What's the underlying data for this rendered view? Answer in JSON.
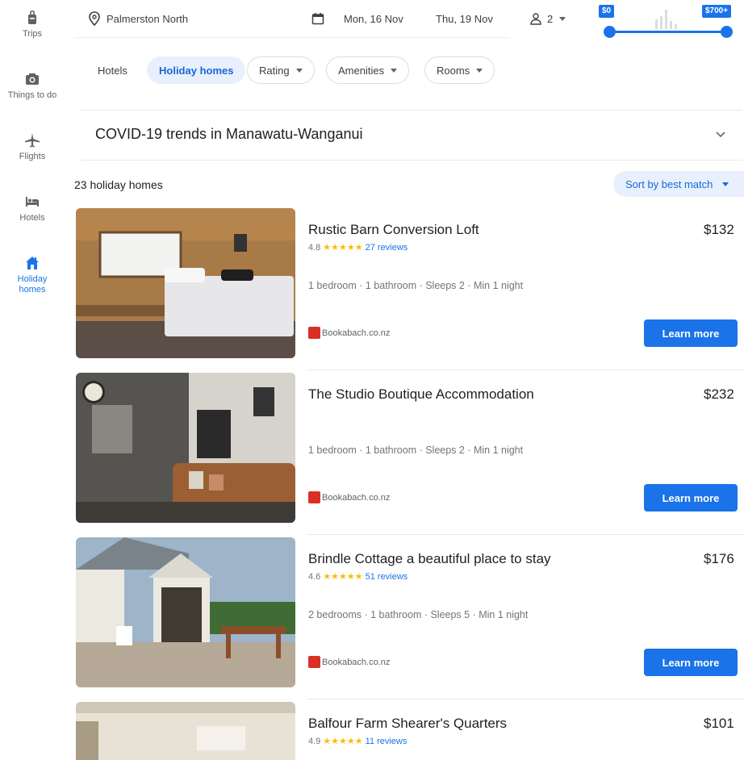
{
  "sidebar": {
    "items": [
      {
        "label": "Trips",
        "icon": "luggage-icon"
      },
      {
        "label": "Things to do",
        "icon": "camera-icon"
      },
      {
        "label": "Flights",
        "icon": "airplane-icon"
      },
      {
        "label": "Hotels",
        "icon": "bed-icon"
      },
      {
        "label": "Holiday homes",
        "icon": "house-icon",
        "active": true
      }
    ]
  },
  "search": {
    "location": "Palmerston North",
    "check_in": "Mon, 16 Nov",
    "check_out": "Thu, 19 Nov",
    "guests": "2"
  },
  "price_filter": {
    "min_label": "$0",
    "max_label": "$700+"
  },
  "filters": {
    "hotels": "Hotels",
    "holiday_homes": "Holiday homes",
    "rating": "Rating",
    "amenities": "Amenities",
    "rooms": "Rooms"
  },
  "covid": {
    "title": "COVID-19 trends in Manawatu-Wanganui"
  },
  "results": {
    "count_label": "23 holiday homes",
    "sort_label": "Sort by best match"
  },
  "listings": [
    {
      "title": "Rustic Barn Conversion Loft",
      "price": "$132",
      "rating": "4.8",
      "stars": "★★★★★",
      "reviews": "27 reviews",
      "facts": "1 bedroom · 1 bathroom · Sleeps 2 · Min 1 night",
      "provider": "Bookabach.co.nz",
      "cta": "Learn more"
    },
    {
      "title": "The Studio Boutique Accommodation",
      "price": "$232",
      "rating": "",
      "stars": "",
      "reviews": "",
      "facts": "1 bedroom · 1 bathroom · Sleeps 2 · Min 1 night",
      "provider": "Bookabach.co.nz",
      "cta": "Learn more"
    },
    {
      "title": "Brindle Cottage a beautiful place to stay",
      "price": "$176",
      "rating": "4.6",
      "stars": "★★★★★",
      "reviews": "51 reviews",
      "facts": "2 bedrooms · 1 bathroom · Sleeps 5 · Min 1 night",
      "provider": "Bookabach.co.nz",
      "cta": "Learn more"
    },
    {
      "title": "Balfour Farm Shearer's Quarters",
      "price": "$101",
      "rating": "4.9",
      "stars": "★★★★★",
      "reviews": "11 reviews"
    }
  ],
  "colors": {
    "accent": "#1a73e8",
    "star": "#fbbc04",
    "provider_logo": "#d93025"
  }
}
